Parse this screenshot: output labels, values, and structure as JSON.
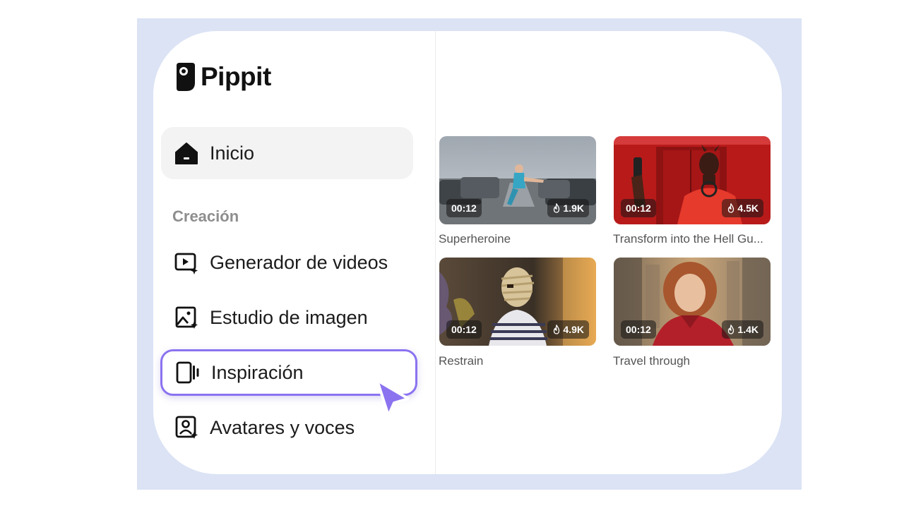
{
  "brand": {
    "name": "Pippit"
  },
  "nav": {
    "home": {
      "label": "Inicio",
      "icon": "home-icon"
    },
    "section": "Creación",
    "items": [
      {
        "label": "Generador de videos",
        "icon": "video-generator-icon"
      },
      {
        "label": "Estudio de imagen",
        "icon": "image-studio-icon"
      },
      {
        "label": "Inspiración",
        "icon": "inspiration-icon",
        "active": true
      },
      {
        "label": "Avatares y voces",
        "icon": "avatar-voice-icon"
      }
    ]
  },
  "videos": [
    {
      "title": "Superheroine",
      "duration": "00:12",
      "views": "1.9K"
    },
    {
      "title": "Transform into the Hell Gu...",
      "duration": "00:12",
      "views": "4.5K"
    },
    {
      "title": "Restrain",
      "duration": "00:12",
      "views": "4.9K"
    },
    {
      "title": "Travel through",
      "duration": "00:12",
      "views": "1.4K"
    }
  ],
  "colors": {
    "accent": "#8b73f0",
    "backdrop": "#dbe3f5"
  }
}
